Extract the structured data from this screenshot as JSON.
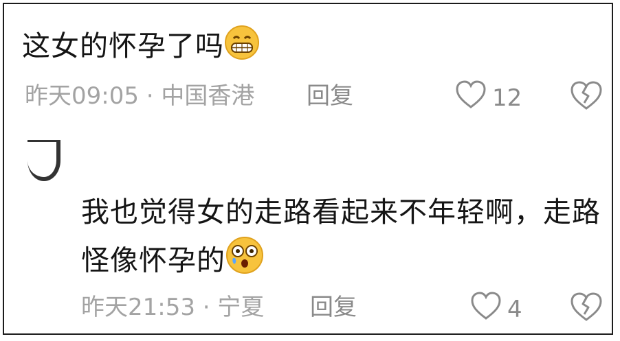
{
  "comment1": {
    "text": "这女的怀孕了吗",
    "emoji": "grin-emoji",
    "time": "昨天09:05",
    "location": "中国香港",
    "reply_label": "回复",
    "likes": "12"
  },
  "comment2": {
    "text": "我也觉得女的走路看起来不年轻啊，走路怪像怀孕的",
    "emoji": "astonished-emoji",
    "time": "昨天21:53",
    "location": "宁夏",
    "reply_label": "回复",
    "likes": "4"
  },
  "separator": " · ",
  "colors": {
    "text": "#151515",
    "meta": "#a3a3a3",
    "icon": "#8a8a8a",
    "border": "#1c1c1c"
  }
}
